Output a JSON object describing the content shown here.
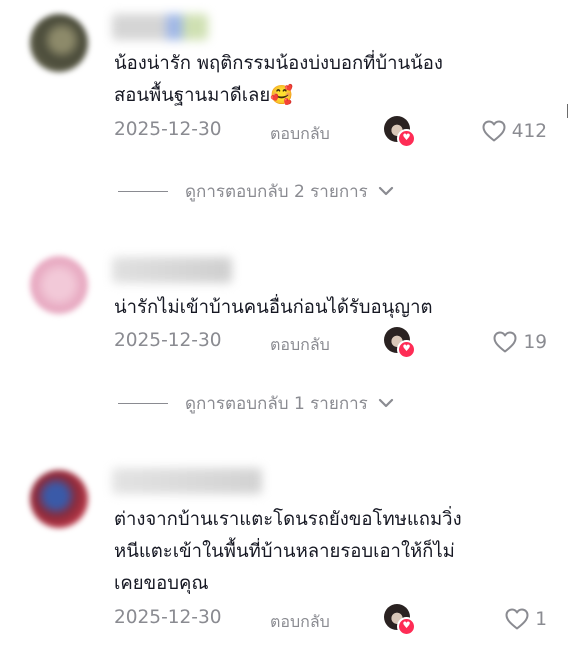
{
  "comments": [
    {
      "username": "xxxxxxxx",
      "text": "น้องน่ารัก พฤติกรรมน้องบ่งบอกที่บ้านน้อง\nสอนพื้นฐานมาดีเลย🥰",
      "date": "2025-12-30",
      "reply_label": "ตอบกลับ",
      "likes": "412",
      "view_replies": "ดูการตอบกลับ 2 รายการ"
    },
    {
      "username": "xxxxxxx_x",
      "text": "น่ารักไม่เข้าบ้านคนอื่นก่อนได้รับอนุญาต",
      "date": "2025-12-30",
      "reply_label": "ตอบกลับ",
      "likes": "19",
      "view_replies": "ดูการตอบกลับ 1 รายการ"
    },
    {
      "username": "xxxxxxxxxxx",
      "text": "ต่างจากบ้านเราแตะโดนรถยังขอโทษแถมวิ่ง\nหนีแตะเข้าในพื้นที่บ้านหลายรอบเอาให้ก็ไม่\nเคยขอบคุณ",
      "date": "2025-12-30",
      "reply_label": "ตอบกลับ",
      "likes": "1"
    }
  ],
  "colors": {
    "text_primary": "#161823",
    "text_secondary": "#8a8b91",
    "accent_badge": "#fe2c55"
  },
  "icons": {
    "like": "heart-outline-icon",
    "expand": "chevron-down-icon",
    "creator_badge": "heart-badge-icon"
  }
}
